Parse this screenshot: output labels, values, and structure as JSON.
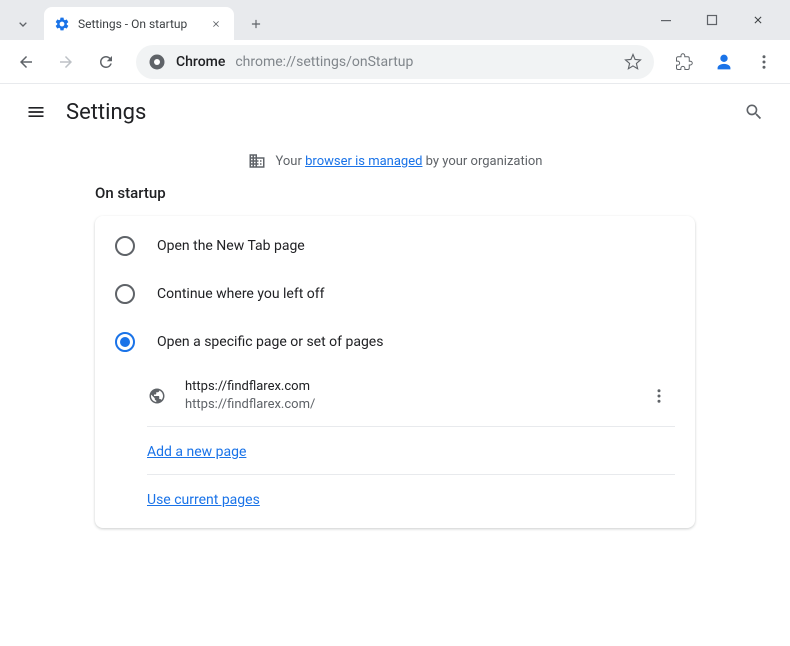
{
  "tab": {
    "title": "Settings - On startup"
  },
  "omnibox": {
    "chip": "Chrome",
    "url": "chrome://settings/onStartup"
  },
  "header": {
    "title": "Settings"
  },
  "managed": {
    "prefix": "Your ",
    "link": "browser is managed",
    "suffix": " by your organization"
  },
  "section": {
    "title": "On startup"
  },
  "radios": {
    "option1": "Open the New Tab page",
    "option2": "Continue where you left off",
    "option3": "Open a specific page or set of pages"
  },
  "pages": [
    {
      "title": "https://findflarex.com",
      "url": "https://findflarex.com/"
    }
  ],
  "links": {
    "add": "Add a new page",
    "use_current": "Use current pages"
  }
}
